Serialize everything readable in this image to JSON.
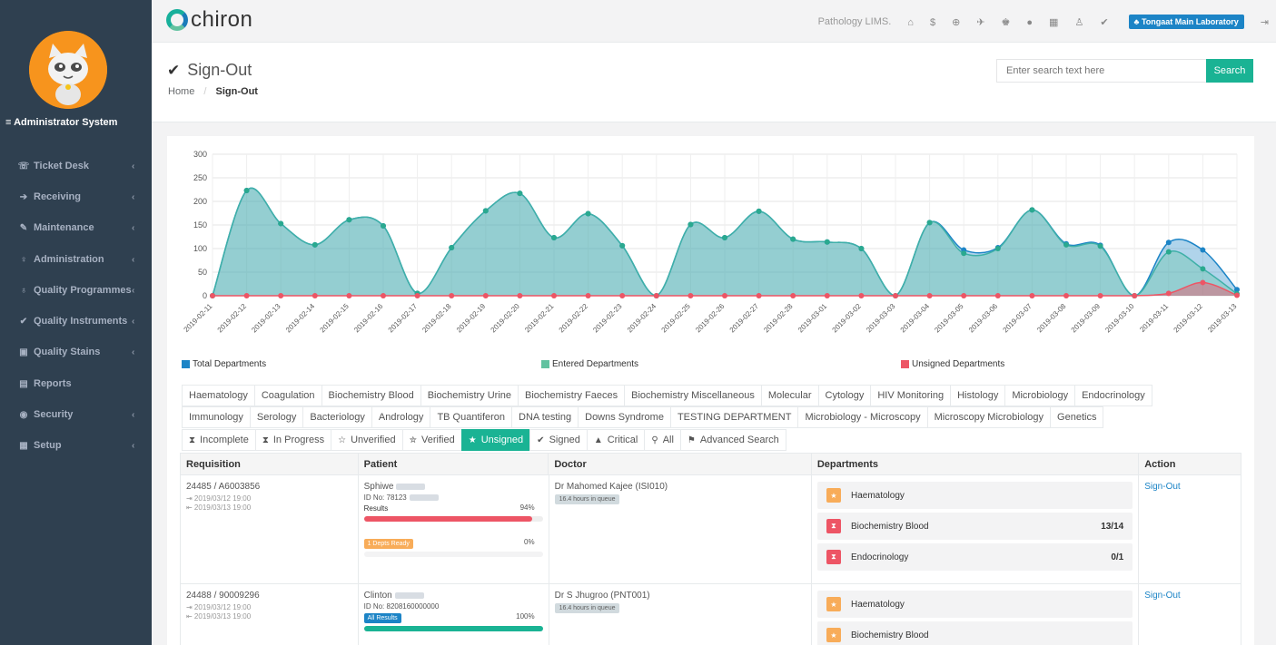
{
  "sidebar": {
    "admin_title": "≡ Administrator System",
    "items": [
      {
        "icon": "☏",
        "label": "Ticket Desk",
        "chev": "‹",
        "name": "sidebar-item-ticket-desk"
      },
      {
        "icon": "➔",
        "label": "Receiving",
        "chev": "‹",
        "name": "sidebar-item-receiving"
      },
      {
        "icon": "✎",
        "label": "Maintenance",
        "chev": "‹",
        "name": "sidebar-item-maintenance"
      },
      {
        "icon": "♀",
        "label": "Administration",
        "chev": "‹",
        "name": "sidebar-item-administration"
      },
      {
        "icon": "♁",
        "label": "Quality Programmes",
        "chev": "‹",
        "name": "sidebar-item-quality-programmes"
      },
      {
        "icon": "✔",
        "label": "Quality Instruments",
        "chev": "‹",
        "name": "sidebar-item-quality-instruments"
      },
      {
        "icon": "▣",
        "label": "Quality Stains",
        "chev": "‹",
        "name": "sidebar-item-quality-stains"
      },
      {
        "icon": "▤",
        "label": "Reports",
        "chev": "",
        "name": "sidebar-item-reports"
      },
      {
        "icon": "◉",
        "label": "Security",
        "chev": "‹",
        "name": "sidebar-item-security"
      },
      {
        "icon": "▦",
        "label": "Setup",
        "chev": "‹",
        "name": "sidebar-item-setup"
      }
    ]
  },
  "topbar": {
    "logo_text": "chiron",
    "system_name": "Pathology LIMS.",
    "icons": [
      "home-icon",
      "dollar-icon",
      "globe-icon",
      "pin-icon",
      "users-icon",
      "info-icon",
      "calendar-icon",
      "flask-icon",
      "check-icon"
    ],
    "icon_glyphs": [
      "⌂",
      "$",
      "⊕",
      "✈",
      "♚",
      "●",
      "▦",
      "♙",
      "✔"
    ],
    "lab_badge": "♣ Tongaat Main Laboratory",
    "logout_glyph": "⇥"
  },
  "header": {
    "title": "Sign-Out",
    "check_glyph": "✔",
    "breadcrumb_home": "Home",
    "breadcrumb_sep": "/",
    "breadcrumb_current": "Sign-Out",
    "search_placeholder": "Enter search text here",
    "search_button": "Search"
  },
  "colors": {
    "total": "#1c84c6",
    "entered": "#62c2a0",
    "unsigned": "#ed5565",
    "teal_fill": "#8ecfd6",
    "teal_line": "#3fb0b0"
  },
  "chart_data": {
    "type": "area",
    "x": [
      "2019-02-11",
      "2019-02-12",
      "2019-02-13",
      "2019-02-14",
      "2019-02-15",
      "2019-02-16",
      "2019-02-17",
      "2019-02-18",
      "2019-02-19",
      "2019-02-20",
      "2019-02-21",
      "2019-02-22",
      "2019-02-23",
      "2019-02-24",
      "2019-02-25",
      "2019-02-26",
      "2019-02-27",
      "2019-02-28",
      "2019-03-01",
      "2019-03-02",
      "2019-03-03",
      "2019-03-04",
      "2019-03-05",
      "2019-03-06",
      "2019-03-07",
      "2019-03-08",
      "2019-03-09",
      "2019-03-10",
      "2019-03-11",
      "2019-03-12",
      "2019-03-13"
    ],
    "yticks": [
      0,
      50,
      100,
      150,
      200,
      250,
      300
    ],
    "ylim": [
      0,
      300
    ],
    "series": [
      {
        "name": "Total Departments",
        "values": [
          0,
          223,
          153,
          108,
          161,
          148,
          5,
          102,
          180,
          217,
          123,
          174,
          106,
          0,
          151,
          123,
          179,
          120,
          114,
          100,
          0,
          155,
          97,
          102,
          182,
          110,
          107,
          0,
          113,
          97,
          13
        ]
      },
      {
        "name": "Entered Departments",
        "values": [
          0,
          223,
          153,
          108,
          161,
          148,
          5,
          102,
          180,
          217,
          123,
          174,
          106,
          0,
          151,
          123,
          179,
          120,
          114,
          100,
          0,
          155,
          90,
          100,
          182,
          108,
          105,
          0,
          93,
          57,
          4
        ]
      },
      {
        "name": "Unsigned Departments",
        "values": [
          0,
          0,
          0,
          0,
          0,
          0,
          0,
          0,
          0,
          0,
          0,
          0,
          0,
          0,
          0,
          0,
          0,
          0,
          0,
          0,
          0,
          0,
          0,
          0,
          0,
          0,
          0,
          0,
          5,
          28,
          1
        ]
      }
    ],
    "legend": "bottom"
  },
  "dept_tabs_row1": [
    "Haematology",
    "Coagulation",
    "Biochemistry Blood",
    "Biochemistry Urine",
    "Biochemistry Faeces",
    "Biochemistry Miscellaneous",
    "Molecular",
    "Cytology",
    "HIV Monitoring",
    "Histology",
    "Microbiology",
    "Endocrinology"
  ],
  "dept_tabs_row2": [
    "Immunology",
    "Serology",
    "Bacteriology",
    "Andrology",
    "TB Quantiferon",
    "DNA testing",
    "Downs Syndrome",
    "TESTING DEPARTMENT",
    "Microbiology - Microscopy",
    "Microscopy Microbiology",
    "Genetics"
  ],
  "status_tabs": [
    {
      "icon": "⧗",
      "label": "Incomplete",
      "name": "tab-incomplete"
    },
    {
      "icon": "⧗",
      "label": "In Progress",
      "name": "tab-in-progress"
    },
    {
      "icon": "☆",
      "label": "Unverified",
      "name": "tab-unverified"
    },
    {
      "icon": "✮",
      "label": "Verified",
      "name": "tab-verified"
    },
    {
      "icon": "★",
      "label": "Unsigned",
      "name": "tab-unsigned",
      "active": true
    },
    {
      "icon": "✔",
      "label": "Signed",
      "name": "tab-signed"
    },
    {
      "icon": "▲",
      "label": "Critical",
      "name": "tab-critical"
    },
    {
      "icon": "⚲",
      "label": "All",
      "name": "tab-all"
    },
    {
      "icon": "⚑",
      "label": "Advanced Search",
      "name": "tab-advanced-search"
    }
  ],
  "table": {
    "headers": [
      "Requisition",
      "Patient",
      "Doctor",
      "Departments",
      "Action"
    ],
    "rows": [
      {
        "requisition": "24485 / A6003856",
        "received": "⇥ 2019/03/12 19:00",
        "due": "⇤ 2019/03/13 19:00",
        "patient": "Sphiwe",
        "id_no": "ID No: 78123",
        "results_label": "Results",
        "results_pct": "94%",
        "results_fill": 0.94,
        "ready_badge": "1 Depts Ready",
        "ready_pct": "0%",
        "doctor": "Dr Mahomed Kajee (ISI010)",
        "queue": "16.4 hours in queue",
        "departments": [
          {
            "name": "Haematology",
            "count": "",
            "icon": "★",
            "color": "#f8ac59"
          },
          {
            "name": "Biochemistry Blood",
            "count": "13/14",
            "icon": "⧗",
            "color": "#ed5565"
          },
          {
            "name": "Endocrinology",
            "count": "0/1",
            "icon": "⧗",
            "color": "#ed5565"
          }
        ],
        "action": "Sign-Out"
      },
      {
        "requisition": "24488 / 90009296",
        "received": "⇥ 2019/03/12 19:00",
        "due": "⇤ 2019/03/13 19:00",
        "patient": "Clinton",
        "id_no": "ID No: 8208160000000",
        "results_label": "All Results",
        "results_pct": "100%",
        "results_fill": 1.0,
        "doctor": "Dr S Jhugroo (PNT001)",
        "queue": "16.4 hours in queue",
        "departments": [
          {
            "name": "Haematology",
            "count": "",
            "icon": "★",
            "color": "#f8ac59"
          },
          {
            "name": "Biochemistry Blood",
            "count": "",
            "icon": "★",
            "color": "#f8ac59"
          }
        ],
        "action": "Sign-Out"
      }
    ]
  }
}
